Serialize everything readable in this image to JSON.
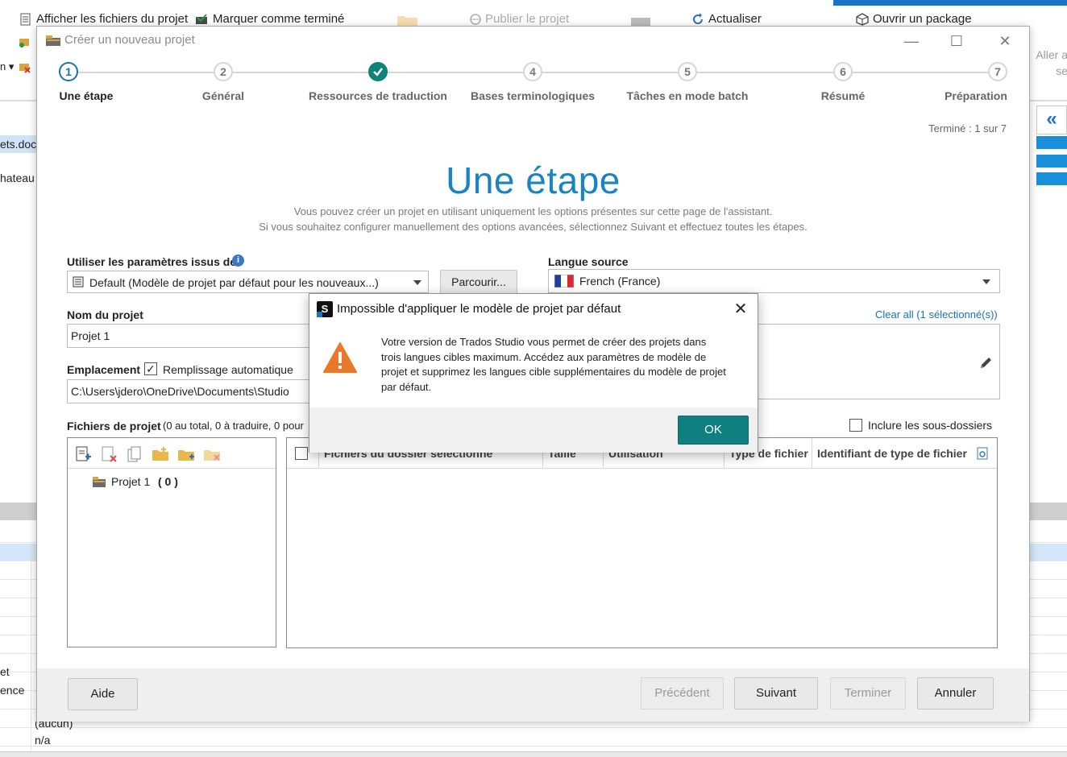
{
  "background_app": {
    "ribbon": {
      "show_files": "Afficher les fichiers du projet",
      "mark_done": "Marquer comme terminé",
      "publish": "Publier le projet",
      "refresh": "Actualiser",
      "open_package": "Ouvrir un package",
      "goto": "Aller a se"
    },
    "left_list": {
      "item1": "ets.docx",
      "item2": "hateau",
      "item3": "et",
      "item4": "ence"
    },
    "lower_values": {
      "val1": "(aucun)",
      "val2": "n/a"
    }
  },
  "wizard": {
    "title": "Créer un nouveau projet",
    "steps": [
      {
        "num": "1",
        "label": "Une étape",
        "state": "active"
      },
      {
        "num": "2",
        "label": "Général",
        "state": "pending"
      },
      {
        "num": "",
        "label": "Ressources de traduction",
        "state": "done"
      },
      {
        "num": "4",
        "label": "Bases terminologiques",
        "state": "pending"
      },
      {
        "num": "5",
        "label": "Tâches en mode batch",
        "state": "pending"
      },
      {
        "num": "6",
        "label": "Résumé",
        "state": "pending"
      },
      {
        "num": "7",
        "label": "Préparation",
        "state": "pending"
      }
    ],
    "progress": "Terminé : 1 sur 7",
    "heading": "Une étape",
    "description_line1": "Vous pouvez créer un projet en utilisant uniquement les options présentes sur cette page de l'assistant.",
    "description_line2": "Si vous souhaitez configurer manuellement des options avancées, sélectionnez Suivant et effectuez toutes les étapes.",
    "template": {
      "label": "Utiliser les paramètres issus de",
      "value": "Default (Modèle de projet par défaut pour les nouveaux...)",
      "browse": "Parcourir..."
    },
    "source_language": {
      "label": "Langue source",
      "value": "French (France)"
    },
    "project_name": {
      "label": "Nom du projet",
      "value": "Projet 1"
    },
    "clear_all": "Clear all (1 sélectionné(s))",
    "location": {
      "label": "Emplacement",
      "autofill_label": "Remplissage automatique",
      "autofill_checked": true,
      "value": "C:\\Users\\jdero\\OneDrive\\Documents\\Studio"
    },
    "project_files": {
      "label": "Fichiers de projet",
      "summary": "(0 au total, 0 à traduire, 0 pour",
      "include_subfolders": "Inclure les sous-dossiers",
      "tree_root": "Projet 1",
      "tree_count": "( 0 )",
      "columns": [
        "Fichiers du dossier sélectionné",
        "Taille",
        "Utilisation",
        "Type de fichier",
        "Identifiant de type de fichier"
      ]
    },
    "footer": {
      "help": "Aide",
      "previous": "Précédent",
      "next": "Suivant",
      "finish": "Terminer",
      "cancel": "Annuler"
    }
  },
  "message_box": {
    "title": "Impossible d'appliquer le modèle de projet par défaut",
    "body": "Votre version de Trados Studio vous permet de créer des projets dans trois langues cibles maximum. Accédez aux paramètres de modèle de projet et supprimez les langues cible supplémentaires du modèle de projet par défaut.",
    "ok": "OK",
    "close": "✕"
  },
  "icons": {
    "warning": "warning-triangle-icon",
    "info": "info-icon",
    "edit": "pencil-icon",
    "flag": "france-flag-icon",
    "collapse": "double-chevron-left-icon"
  },
  "colors": {
    "accent_heading": "#1a83c4",
    "step_done": "#0f8378",
    "ok_button": "#0f7f80",
    "warning": "#e8792b"
  }
}
